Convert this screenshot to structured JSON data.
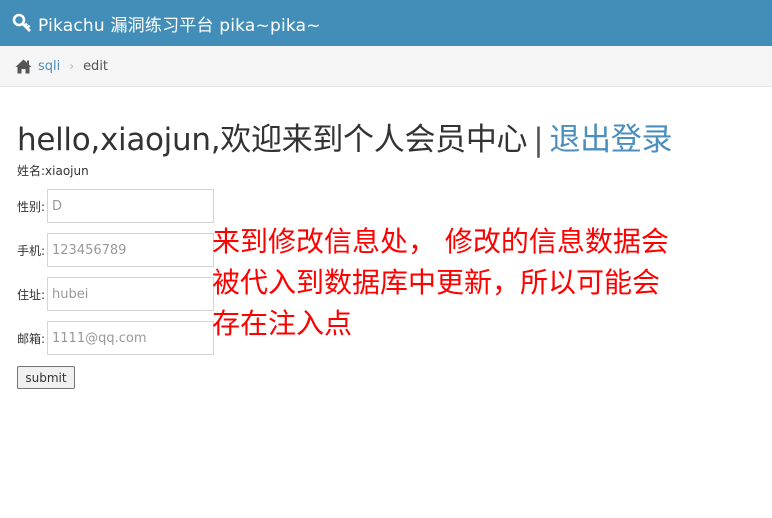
{
  "navbar": {
    "brand": "Pikachu 漏洞练习平台 pika~pika~"
  },
  "breadcrumb": {
    "home": "sqli",
    "current": "edit"
  },
  "main": {
    "greeting": "hello,xiaojun,欢迎来到个人会员中心",
    "divider": "|",
    "logout_label": "退出登录",
    "name_line": "姓名:xiaojun"
  },
  "form": {
    "sex": {
      "label": "性别:",
      "placeholder": "D"
    },
    "phone": {
      "label": "手机:",
      "placeholder": "123456789"
    },
    "address": {
      "label": "住址:",
      "placeholder": "hubei"
    },
    "email": {
      "label": "邮箱:",
      "placeholder": "1111@qq.com"
    },
    "submit_label": "submit"
  },
  "annotation": {
    "text": "来到修改信息处， 修改的信息数据会被代入到数据库中更新，所以可能会存在注入点",
    "color": "#ff0000"
  },
  "colors": {
    "navbar": "#438eb9",
    "link": "#4c8fbd"
  },
  "icons": {
    "brand": "key-icon",
    "home": "home-icon",
    "separator": "chevron-right-icon"
  }
}
